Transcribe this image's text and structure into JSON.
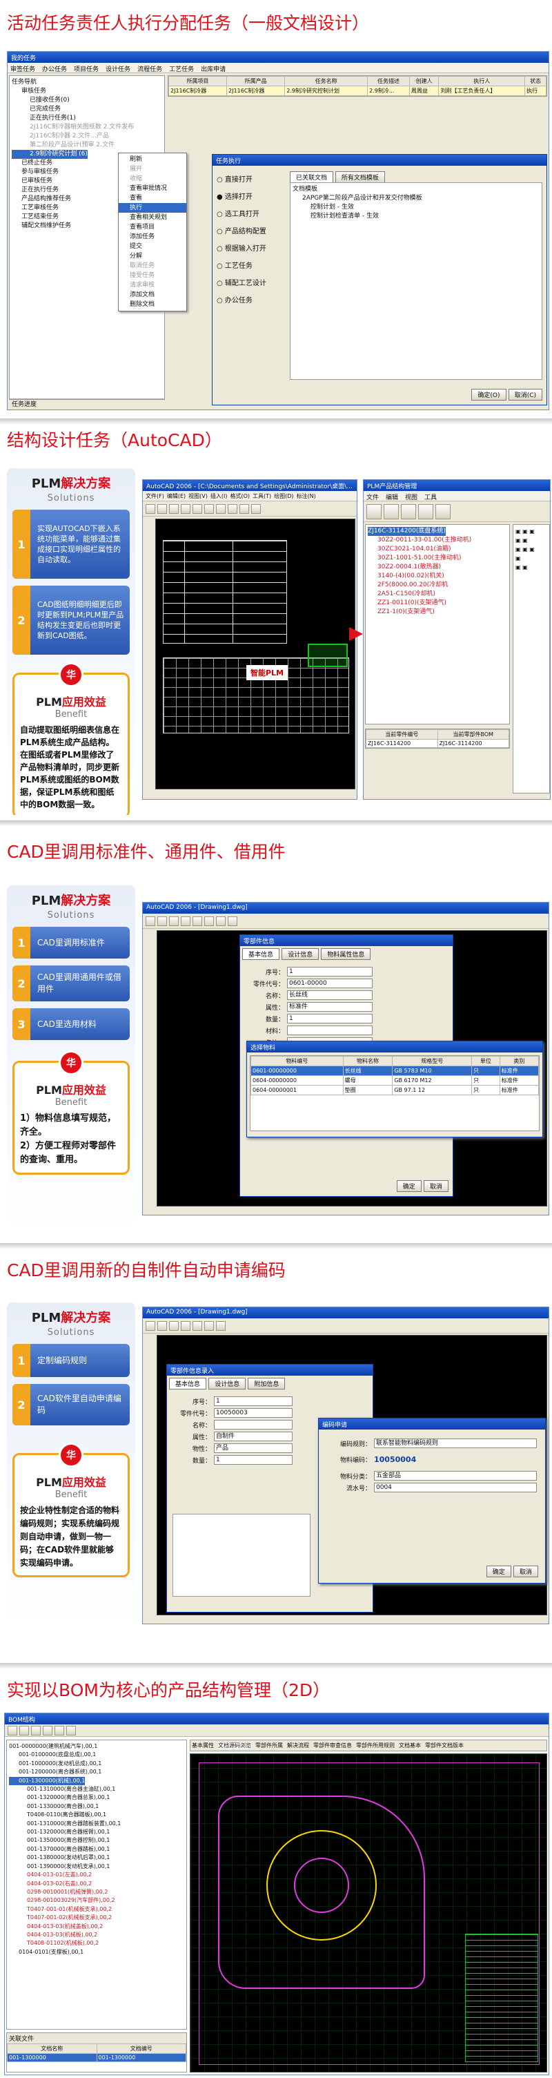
{
  "sections": {
    "s1": {
      "title": "活动任务责任人执行分配任务（一般文档设计）"
    },
    "s2": {
      "title": "结构设计任务（AutoCAD）"
    },
    "s3": {
      "title": "CAD里调用标准件、通用件、借用件"
    },
    "s4": {
      "title": "CAD里调用新的自制件自动申请编码"
    },
    "s5": {
      "title": "实现以BOM为核心的产品结构管理（2D）"
    }
  },
  "plm": {
    "sol_title_a": "PLM",
    "sol_title_b": "解决方案",
    "sol_sub": "Solutions",
    "ben_title_a": "PLM",
    "ben_title_b": "应用效益",
    "ben_sub": "Benefit",
    "badge": "华"
  },
  "s1": {
    "window_title": "我的任务",
    "menus": [
      "审签任务",
      "办公任务",
      "项目任务",
      "设计任务",
      "流程任务",
      "工艺任务",
      "出库申请"
    ],
    "tree": [
      "任务导航",
      "审核任务",
      "已接收任务(0)",
      "已完成任务",
      "正在执行任务(1)",
      "2J116C制冷器相关图纸数 2.文件发布",
      "2J116C制冷器 2.文件...产品",
      "第二阶段产品设计(预审 2.文件",
      "2.9制冷研究计划 (6)",
      "已终止任务",
      "参与审核任务",
      "已审核任务",
      "正在执行任务",
      "产品结构推荐任务",
      "工艺审核任务",
      "工艺结束任务",
      "辅配文档维护任务"
    ],
    "table_headers": [
      "所属项目",
      "所属产品",
      "任务名称",
      "任务描述",
      "创建人",
      "执行人",
      "状态"
    ],
    "table_row": [
      "2J116C制冷器",
      "2J116C制冷器",
      "2.9制冷研究控制计划",
      "2.9制冷...",
      "周周益",
      "刘刚【工艺负责任人】",
      "执行"
    ],
    "context_menu": [
      "刷新",
      "展开",
      "收缩",
      "查看审批情况",
      "查看",
      "执行",
      "查看相关规划",
      "查看项目",
      "添加任务",
      "提交",
      "分解",
      "取消任务",
      "接受任务",
      "请求审核",
      "添加文档",
      "删除文档"
    ],
    "dialog_title": "任务执行",
    "dialog_options": [
      "直接打开",
      "选择打开",
      "选工具打开",
      "产品结构配置",
      "根据输入打开",
      "工艺任务",
      "辅配工艺设计",
      "办公任务"
    ],
    "dialog_tabs": [
      "已关联文档",
      "所有文档模板"
    ],
    "dialog_tree": [
      "文档模板",
      "2APGP第二阶段产品设计和开发交付物模板",
      "控制计划 - 生效",
      "控制计划检查清单 - 生效"
    ],
    "status_text": "任务进度",
    "ok": "确定(O)",
    "cancel": "取消(C)"
  },
  "s2": {
    "items": [
      {
        "n": "1",
        "text": "实现AUTOCAD下嵌入系统功能菜单，能够通过集成接口实现明细栏属性的自动读取。"
      },
      {
        "n": "2",
        "text": "CAD图纸明细明细更后即时更新到PLM;PLM里产品结构发生变更后也即时更新到CAD图纸。"
      }
    ],
    "benefit_text": "自动提取图纸明细表信息在PLM系统生成产品结构。在图纸或者PLM里修改了产品物料清单时，同步更新PLM系统或图纸的BOM数据，保证PLM系统和图纸中的BOM数据一致。",
    "cad_title": "AutoCAD 2006 - [C:\\Documents and Settings\\Administrator\\桌面\\...",
    "cad_menus": [
      "文件(F)",
      "编辑(E)",
      "视图(V)",
      "插入(I)",
      "格式(O)",
      "工具(T)",
      "绘图(D)",
      "标注(N)",
      "修改(M)",
      "窗口(W)",
      "帮助(H)"
    ],
    "plm_title": "PLM产品结构管理",
    "plm_menus": [
      "文件",
      "编辑",
      "视图",
      "工具"
    ],
    "plm_tree": [
      "ZJ16C-3114200(底盘系统)",
      "30Z2-0011-33-01.00(主推动机)",
      "30ZC3021-104.01(油箱)",
      "30Z1-1001-51.00(主推动机)",
      "30Z2-0004.1(散热器)",
      "3140-(4)(00.02)(机关)",
      "2F5(8000.00.20(冷却机",
      "2A51-C150(冷却机)",
      "ZZ1-0011(0)(支架通气)",
      "ZZ1-1(0)(支架通气)"
    ],
    "title_block": "智能PLM",
    "plm_bottom": [
      "ZJ16C-3114200",
      "ZJ16C-3114200"
    ],
    "plm_bottom_labels": [
      "当前零件编号",
      "当前零部件BOM"
    ]
  },
  "s3": {
    "items": [
      {
        "n": "1",
        "text": "CAD里调用标准件"
      },
      {
        "n": "2",
        "text": "CAD里调用通用件或借用件"
      },
      {
        "n": "3",
        "text": "CAD里选用材料"
      }
    ],
    "benefit_text": "1）物料信息填写规范，齐全。\n2）方便工程师对零部件的查询、重用。",
    "cad_title": "AutoCAD 2006 - [Drawing1.dwg]",
    "dlg_title": "零部件信息",
    "dlg_tabs": [
      "基本信息",
      "设计信息",
      "物料属性信息"
    ],
    "fields": [
      {
        "label": "序号：",
        "value": "1"
      },
      {
        "label": "零件代号：",
        "value": "0601-00000"
      },
      {
        "label": "名称：",
        "value": "长丝线"
      },
      {
        "label": "属性：",
        "value": "标准件"
      },
      {
        "label": "数量：",
        "value": "1"
      },
      {
        "label": "材料：",
        "value": ""
      },
      {
        "label": "备注：",
        "value": ""
      }
    ],
    "sub_title": "选择物料",
    "table_headers": [
      "物料编号",
      "物料名称",
      "规格型号",
      "单位",
      "类别"
    ],
    "table_rows": [
      [
        "0601-00000000",
        "长丝线",
        "GB 5783 M10",
        "只",
        "标准件"
      ],
      [
        "0604-00000000",
        "螺母",
        "GB 6170 M12",
        "只",
        "标准件"
      ],
      [
        "0604-00000001",
        "垫圈",
        "GB 97.1 12",
        "只",
        "标准件"
      ]
    ],
    "ok": "确定",
    "cancel": "取消"
  },
  "s4": {
    "items": [
      {
        "n": "1",
        "text": "定制编码规则"
      },
      {
        "n": "2",
        "text": "CAD软件里自动申请编码"
      }
    ],
    "benefit_text": "按企业特性制定合适的物料编码规则；实现系统编码规则自动申请，做到一物一码；在CAD软件里就能够实现编码申请。",
    "cad_title": "AutoCAD 2006 - [Drawing1.dwg]",
    "dlg_title": "零部件信息录入",
    "dlg_tabs": [
      "基本信息",
      "设计信息",
      "附加信息"
    ],
    "fields": [
      {
        "label": "序号：",
        "value": "1"
      },
      {
        "label": "零件代号：",
        "value": "10050003"
      },
      {
        "label": "名称：",
        "value": ""
      },
      {
        "label": "属性：",
        "value": "自制件"
      },
      {
        "label": "物性：",
        "value": "产品"
      },
      {
        "label": "数量：",
        "value": "1"
      }
    ],
    "code_title": "编码申请",
    "code_rule_label": "编码规则：",
    "code_rule": "联系智能物料编码规则",
    "code_label": "物料编码：",
    "code_value": "10050004",
    "category_label": "物料分类：",
    "category_value": "五金部品",
    "serial_label": "流水号：",
    "serial_value": "0004",
    "ok": "确定",
    "cancel": "取消"
  },
  "s5": {
    "left_title": "BOM结构",
    "tree": [
      "001-0000000(建筑机械汽车),00,1",
      "001-0100000(底盘总成),00,1",
      "001-1000000(发动机总成),00,1",
      "001-1200000(离合器系统),00,1",
      "001-1300000(机械),00,1",
      "001-1310000(离合器主油缸),00,1",
      "001-1320000(离合器总泵),00,1",
      "001-1330000(离合器),00,1",
      "T0408-0110(离合器踏板),00,1",
      "001-1310000(离合器踏板装置),00,1",
      "001-1320000(离合器摇臂),00,1",
      "001-1350000(离合器控制),00,1",
      "001-1370000(离合器踏板),00,1",
      "001-1380000(发动机后罩),00,1",
      "001-1390000(发动机支承),00,1",
      "0404-013-01(左盖),00,2",
      "0404-013-02(右盖),00,2",
      "0298-0010001(机械弹簧),00,2",
      "0298-001003029(汽车部件),00,2",
      "T0407-001-01(机械板支承),00,2",
      "T0407-001-02(机械板支承),00,2",
      "0404-013-03(机械盖板),00,2",
      "0404-013-03(机械板),00,2",
      "T0408-01102(机械板),00,2",
      "0104-0101(支撑板),00,1"
    ],
    "right_tabs": [
      "基本属性",
      "文档源码浏览",
      "零部件所属",
      "解决流程",
      "零部件审查信息",
      "零部件所用规则",
      "文档基本",
      "零部件文档版本"
    ],
    "bottom_headers": [
      "文档名称",
      "文档编号"
    ],
    "bottom_row": [
      "001-1300000",
      "001-1300000"
    ],
    "bottom_label": "关联文件"
  }
}
